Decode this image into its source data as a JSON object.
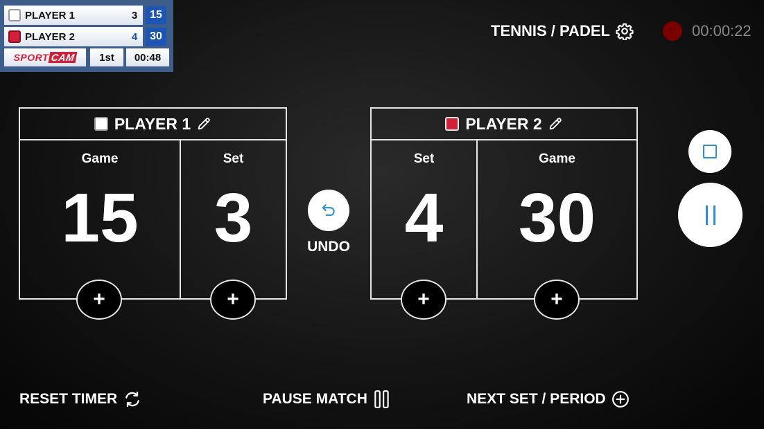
{
  "mini_scoreboard": {
    "player1": {
      "name": "PLAYER 1",
      "set": "3",
      "game": "15",
      "color": "#ffffff"
    },
    "player2": {
      "name": "PLAYER 2",
      "set": "4",
      "game": "30",
      "color": "#d0203a"
    },
    "logo_part1": "SPORT",
    "logo_part2": "CAM",
    "period": "1st",
    "clock": "00:48"
  },
  "header": {
    "sport_label": "TENNIS / PADEL",
    "recording_time": "00:00:22",
    "recording_color": "#7a0000"
  },
  "player1": {
    "name": "PLAYER 1",
    "game_label": "Game",
    "game_value": "15",
    "set_label": "Set",
    "set_value": "3",
    "plus": "+"
  },
  "player2": {
    "name": "PLAYER 2",
    "set_label": "Set",
    "set_value": "4",
    "game_label": "Game",
    "game_value": "30",
    "plus": "+"
  },
  "undo": {
    "label": "UNDO"
  },
  "footer": {
    "reset_timer": "RESET TIMER",
    "pause_match": "PAUSE MATCH",
    "next_set": "NEXT SET / PERIOD"
  },
  "colors": {
    "accent_blue": "#1c55b3",
    "icon_blue": "#2f8fd0",
    "player2_red": "#d0203a"
  },
  "icons": {
    "settings": "gear-icon",
    "edit": "pencil-icon",
    "undo": "undo-icon",
    "stop": "stop-icon",
    "pause": "pause-icon",
    "reset": "refresh-icon",
    "pause_match": "pause-bars-icon",
    "next": "plus-circle-icon"
  }
}
